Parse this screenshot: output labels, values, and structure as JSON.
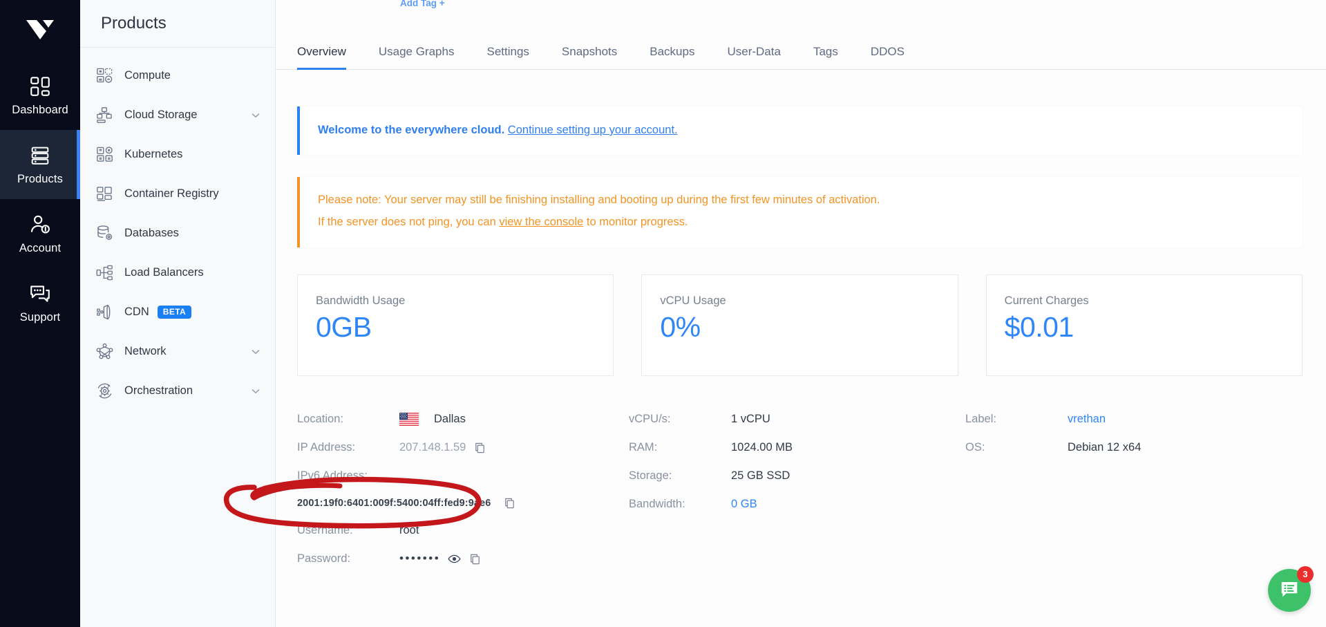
{
  "rail": {
    "logo_icon": "vultr-logo-icon",
    "items": [
      {
        "label": "Dashboard",
        "icon": "grid-icon",
        "active": false
      },
      {
        "label": "Products",
        "icon": "server-stack-icon",
        "active": true
      },
      {
        "label": "Account",
        "icon": "user-icon",
        "active": false
      },
      {
        "label": "Support",
        "icon": "chat-icon",
        "active": false
      }
    ]
  },
  "panel": {
    "title": "Products",
    "items": [
      {
        "label": "Compute",
        "icon": "compute-icon",
        "chevron": false,
        "badge": null
      },
      {
        "label": "Cloud Storage",
        "icon": "cloud-storage-icon",
        "chevron": true,
        "badge": null
      },
      {
        "label": "Kubernetes",
        "icon": "kubernetes-icon",
        "chevron": false,
        "badge": null
      },
      {
        "label": "Container Registry",
        "icon": "container-registry-icon",
        "chevron": false,
        "badge": null
      },
      {
        "label": "Databases",
        "icon": "database-icon",
        "chevron": false,
        "badge": null
      },
      {
        "label": "Load Balancers",
        "icon": "load-balancer-icon",
        "chevron": false,
        "badge": null
      },
      {
        "label": "CDN",
        "icon": "cdn-icon",
        "chevron": false,
        "badge": "BETA"
      },
      {
        "label": "Network",
        "icon": "network-icon",
        "chevron": true,
        "badge": null
      },
      {
        "label": "Orchestration",
        "icon": "orchestration-icon",
        "chevron": true,
        "badge": null
      }
    ]
  },
  "main": {
    "add_tag": "Add Tag +",
    "tabs": [
      {
        "label": "Overview",
        "active": true
      },
      {
        "label": "Usage Graphs",
        "active": false
      },
      {
        "label": "Settings",
        "active": false
      },
      {
        "label": "Snapshots",
        "active": false
      },
      {
        "label": "Backups",
        "active": false
      },
      {
        "label": "User-Data",
        "active": false
      },
      {
        "label": "Tags",
        "active": false
      },
      {
        "label": "DDOS",
        "active": false
      }
    ],
    "banner_welcome": {
      "bold": "Welcome to the everywhere cloud.",
      "link": "Continue setting up your account.",
      "accent": "#2f7ff0"
    },
    "banner_note": {
      "line1": "Please note: Your server may still be finishing installing and booting up during the first few minutes of activation.",
      "line2_pre": "If the server does not ping, you can ",
      "line2_link": "view the console",
      "line2_post": " to monitor progress.",
      "accent": "#f29425"
    },
    "cards": [
      {
        "title": "Bandwidth Usage",
        "value": "0GB",
        "color": "#2f86f6"
      },
      {
        "title": "vCPU Usage",
        "value": "0%",
        "color": "#2f86f6"
      },
      {
        "title": "Current Charges",
        "value": "$0.01",
        "color": "#2f86f6"
      }
    ],
    "details": {
      "col1": [
        {
          "label": "Location:",
          "value": "Dallas",
          "icon": "us-flag-icon",
          "style": "normal",
          "copy": false
        },
        {
          "label": "IP Address:",
          "value": "207.148.1.59",
          "icon": null,
          "style": "muted",
          "copy": true
        }
      ],
      "ipv6": {
        "label": "IPv6 Address:",
        "value": "2001:19f0:6401:009f:5400:04ff:fed9:9ae6",
        "copy": true
      },
      "col1b": [
        {
          "label": "Username:",
          "value": "root",
          "style": "normal",
          "copy": false,
          "eye": false
        },
        {
          "label": "Password:",
          "value": "•••••••",
          "style": "dots",
          "copy": true,
          "eye": true
        }
      ],
      "col2": [
        {
          "label": "vCPU/s:",
          "value": "1 vCPU",
          "style": "normal"
        },
        {
          "label": "RAM:",
          "value": "1024.00 MB",
          "style": "normal"
        },
        {
          "label": "Storage:",
          "value": "25 GB SSD",
          "style": "normal"
        },
        {
          "label": "Bandwidth:",
          "value": "0 GB",
          "style": "link"
        }
      ],
      "col3": [
        {
          "label": "Label:",
          "value": "vrethan",
          "style": "link"
        },
        {
          "label": "OS:",
          "value": "Debian 12 x64",
          "style": "normal"
        }
      ]
    },
    "annotation": {
      "shape": "hand-drawn-ellipse",
      "color": "#c4171b",
      "targets": "IP Address: 207.148.1.59"
    },
    "chat": {
      "icon": "chat-bubble-icon",
      "badge": "3",
      "color": "#3dc26a",
      "badge_color": "#ea2d2d"
    }
  }
}
